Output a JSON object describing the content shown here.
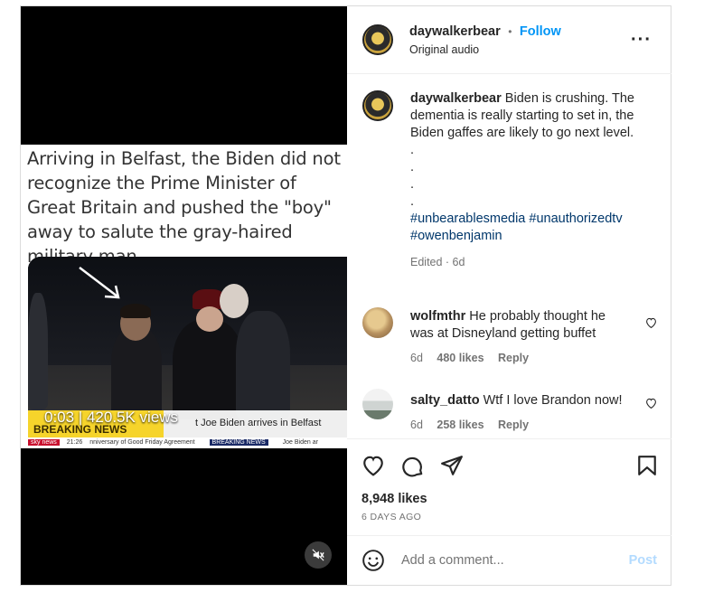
{
  "media": {
    "caption_text": "Arriving in Belfast, the Biden did not recognize the Prime Minister of Great Britain and pushed the \"boy\" away to salute the gray-haired military man.",
    "views_overlay": "0:03 | 420.5K views",
    "ticker_headline": "t Joe Biden arrives in Belfast",
    "ticker_left": "BREAKING NEWS",
    "ticker_channel": "sky news",
    "ticker_time": "21:26",
    "ticker_mid": "nniversary of Good Friday Agreement",
    "ticker_breaking": "BREAKING NEWS",
    "ticker_right": "Joe Biden ar"
  },
  "header": {
    "username": "daywalkerbear",
    "separator": "•",
    "follow_label": "Follow",
    "audio": "Original audio"
  },
  "post_caption": {
    "username": "daywalkerbear",
    "text": "Biden is crushing. The dementia is really starting to set in, the Biden gaffes are likely to go next level.",
    "dots": [
      ".",
      ".",
      ".",
      "."
    ],
    "hashtags_line1": "#unbearablesmedia #unauthorizedtv",
    "hashtags_line2": "#owenbenjamin",
    "edited": "Edited · 6d"
  },
  "comments": [
    {
      "username": "wolfmthr",
      "text": "He probably thought he was at Disneyland getting buffet",
      "age": "6d",
      "likes": "480 likes",
      "reply": "Reply"
    },
    {
      "username": "salty_datto",
      "text": "Wtf I love Brandon now!",
      "age": "6d",
      "likes": "258 likes",
      "reply": "Reply"
    }
  ],
  "actions": {
    "likes": "8,948 likes",
    "date": "6 DAYS AGO"
  },
  "add_comment": {
    "placeholder": "Add a comment...",
    "post_label": "Post"
  },
  "colors": {
    "accent": "#0095f6",
    "hashtag": "#00376b",
    "muted": "#737373"
  }
}
